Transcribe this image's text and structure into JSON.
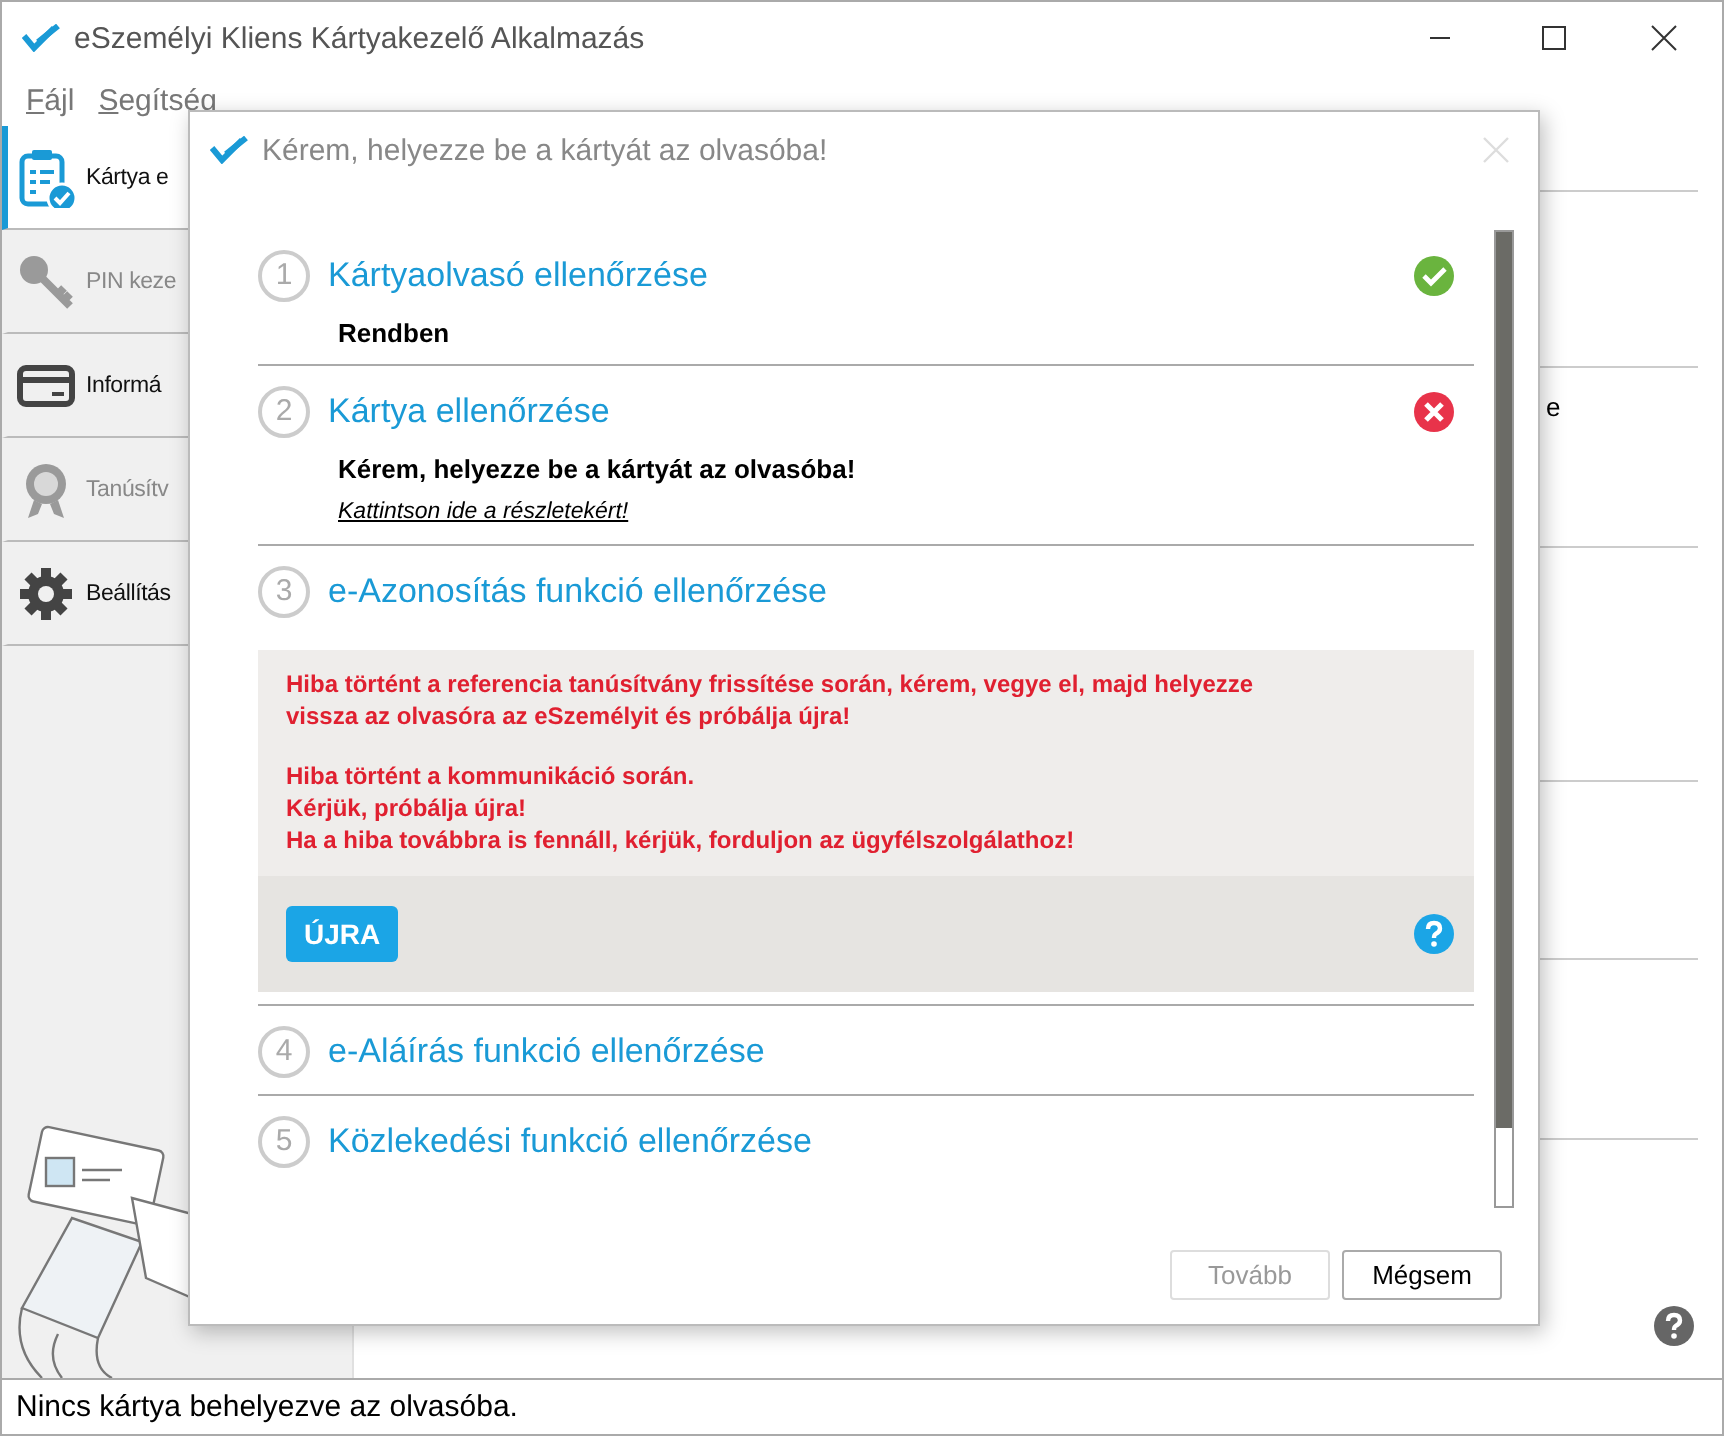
{
  "window": {
    "title": "eSzemélyi Kliens Kártyakezelő Alkalmazás"
  },
  "menu": [
    {
      "label": "Fájl"
    },
    {
      "label": "Segítség"
    }
  ],
  "sidebar": {
    "items": [
      {
        "label": "Kártya e",
        "selected": true,
        "disabled": false
      },
      {
        "label": "PIN keze",
        "selected": false,
        "disabled": true
      },
      {
        "label": "Informá",
        "selected": false,
        "disabled": false
      },
      {
        "label": "Tanúsítv",
        "selected": false,
        "disabled": true
      },
      {
        "label": "Beállítás",
        "selected": false,
        "disabled": false
      }
    ]
  },
  "content": {
    "fragment": "e"
  },
  "dialog": {
    "title": "Kérem, helyezze be a kártyát az olvasóba!",
    "steps": [
      {
        "number": "1",
        "title": "Kártyaolvasó ellenőrzése",
        "kind": "ok",
        "message": "Rendben"
      },
      {
        "number": "2",
        "title": "Kártya ellenőrzése",
        "kind": "error",
        "message": "Kérem, helyezze be a kártyát az olvasóba!",
        "link": "Kattintson ide a részletekért!"
      },
      {
        "number": "3",
        "title": "e-Azonosítás funkció ellenőrzése",
        "kind": "pending",
        "error_panel": {
          "paragraphs": [
            "Hiba történt a referencia tanúsítvány frissítése során, kérem, vegye el, majd helyezze\nvissza az olvasóra az eSzemélyit és próbálja újra!",
            "Hiba történt a kommunikáció során.\nKérjük, próbálja újra!\nHa a hiba továbbra is fennáll, kérjük, forduljon az ügyfélszolgálathoz!"
          ],
          "button": "ÚJRA"
        }
      },
      {
        "number": "4",
        "title": "e-Aláírás funkció ellenőrzése",
        "kind": "pending"
      },
      {
        "number": "5",
        "title": "Közlekedési funkció ellenőrzése",
        "kind": "pending"
      }
    ],
    "buttons": [
      {
        "label": "Tovább",
        "disabled": true
      },
      {
        "label": "Mégsem",
        "disabled": false
      }
    ]
  },
  "status_bar": {
    "text": "Nincs kártya behelyezve az olvasóba."
  }
}
